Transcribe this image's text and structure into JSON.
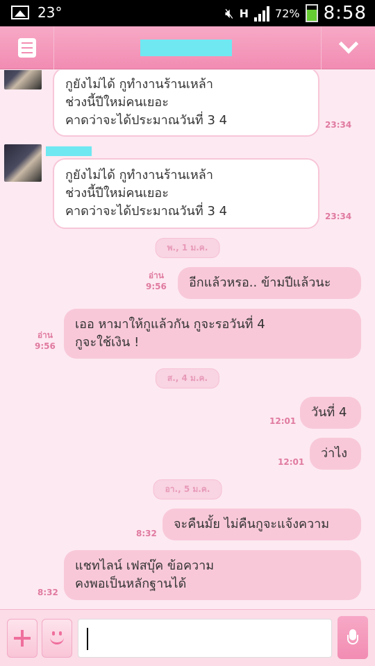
{
  "statusbar": {
    "temperature": "23°",
    "network": "H",
    "battery": "72%",
    "battery_level": 0.72,
    "time": "8:58"
  },
  "header": {
    "title": "",
    "menu_icon": "menu-icon",
    "chevron_icon": "chevron-down-icon"
  },
  "messages": [
    {
      "side": "left",
      "lines": [
        "กูยังไม่ได้ กูทำงานร้านเหล้า",
        "ช่วงนี้ปีใหม่คนเยอะ",
        "คาดว่าจะได้ประมาณวันที่ 3 4"
      ],
      "time": "23:34"
    },
    {
      "side": "left",
      "lines": [
        "กูยังไม่ได้ กูทำงานร้านเหล้า",
        "ช่วงนี้ปีใหม่คนเยอะ",
        "คาดว่าจะได้ประมาณวันที่ 3 4"
      ],
      "time": "23:34"
    },
    {
      "type": "date",
      "text": "พ., 1 ม.ค."
    },
    {
      "side": "right",
      "lines": [
        "อีกแล้วหรอ.. ข้ามปีแล้วนะ"
      ],
      "read": "อ่าน",
      "time": "9:56"
    },
    {
      "side": "right",
      "lines": [
        "เออ หามาให้กูแล้วกัน กูจะรอวันที่ 4",
        "กูจะใช้เงิน !"
      ],
      "read": "อ่าน",
      "time": "9:56"
    },
    {
      "type": "date",
      "text": "ส., 4 ม.ค."
    },
    {
      "side": "right",
      "lines": [
        "วันที่ 4"
      ],
      "time": "12:01"
    },
    {
      "side": "right",
      "lines": [
        "ว่าไง"
      ],
      "time": "12:01"
    },
    {
      "type": "date",
      "text": "อา., 5 ม.ค."
    },
    {
      "side": "right",
      "lines": [
        "จะคืนมั้ย ไม่คืนกูจะแจ้งความ"
      ],
      "time": "8:32"
    },
    {
      "side": "right",
      "lines": [
        "แชทไลน์ เฟสบุ๊ค ข้อความ",
        "คงพอเป็นหลักฐานได้"
      ],
      "time": "8:32"
    }
  ],
  "input": {
    "value": "",
    "plus_icon": "plus-icon",
    "emoji_icon": "smiley-icon",
    "mic_icon": "microphone-icon"
  }
}
